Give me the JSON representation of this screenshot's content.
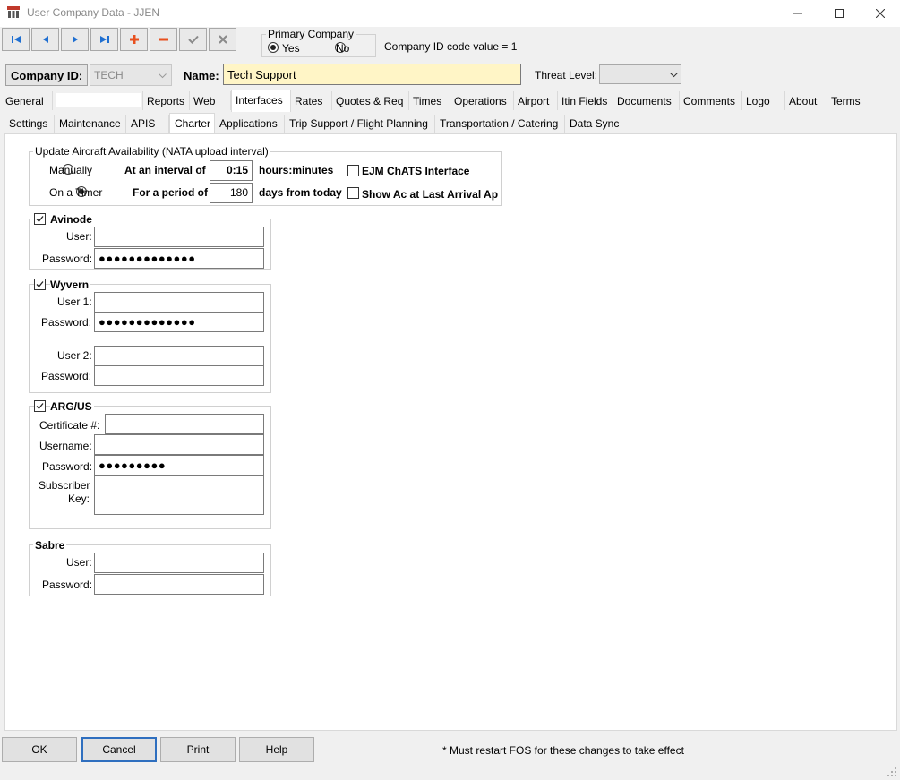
{
  "window": {
    "title": "User Company Data - JJEN",
    "minimize": "minimize",
    "maximize": "maximize",
    "close": "close"
  },
  "toolbar": {
    "icons": [
      "first-record-icon",
      "previous-record-icon",
      "next-record-icon",
      "last-record-icon",
      "add-record-icon",
      "delete-record-icon",
      "accept-icon",
      "cancel-edit-icon"
    ]
  },
  "primary_company": {
    "label": "Primary Company",
    "yes": "Yes",
    "no": "No",
    "selected": "Yes"
  },
  "company_id_code": "Company ID code value = 1",
  "company": {
    "id_label": "Company ID:",
    "id_value": "TECH",
    "name_label": "Name:",
    "name_value": "Tech Support",
    "threat_label": "Threat Level:",
    "threat_value": ""
  },
  "main_tabs": [
    "General",
    "",
    "Reports",
    "Web",
    "Interfaces",
    "Rates",
    "Quotes & Req",
    "Times",
    "Operations",
    "Airport",
    "Itin Fields",
    "Documents",
    "Comments",
    "Logo",
    "About",
    "Terms"
  ],
  "active_main_tab": "Interfaces",
  "sub_tabs": [
    "Settings",
    "Maintenance",
    "APIS",
    "Charter",
    "Applications",
    "Trip Support / Flight Planning",
    "Transportation / Catering",
    "Data Sync"
  ],
  "active_sub_tab": "Charter",
  "aircraft_availability": {
    "legend": "Update Aircraft Availability (NATA upload interval)",
    "manually": "Manually",
    "on_timer": "On a Timer",
    "selected": "On a Timer",
    "interval_label": "At an interval of",
    "interval_value": "0:15",
    "interval_unit": "hours:minutes",
    "period_label": "For a period of",
    "period_value": "180",
    "period_unit": "days from today",
    "ejm_label": "EJM ChATS Interface",
    "ejm_checked": false,
    "show_ac_label": "Show Ac at Last Arrival Ap",
    "show_ac_checked": false
  },
  "avinode": {
    "label": "Avinode",
    "checked": true,
    "user_label": "User:",
    "user_value": "",
    "password_label": "Password:",
    "password_value": "●●●●●●●●●●●●●"
  },
  "wyvern": {
    "label": "Wyvern",
    "checked": true,
    "user1_label": "User 1:",
    "user1_value": "",
    "password1_label": "Password:",
    "password1_value": "●●●●●●●●●●●●●",
    "user2_label": "User 2:",
    "user2_value": "",
    "password2_label": "Password:",
    "password2_value": ""
  },
  "argus": {
    "label": "ARG/US",
    "checked": true,
    "certificate_label": "Certificate #:",
    "certificate_value": "",
    "username_label": "Username:",
    "username_value": "",
    "password_label": "Password:",
    "password_value": "●●●●●●●●●",
    "subscriber_label_1": "Subscriber",
    "subscriber_label_2": "Key:",
    "subscriber_value": ""
  },
  "sabre": {
    "label": "Sabre",
    "user_label": "User:",
    "user_value": "",
    "password_label": "Password:",
    "password_value": ""
  },
  "buttons": {
    "ok": "OK",
    "cancel": "Cancel",
    "print": "Print",
    "help": "Help"
  },
  "restart_note": "* Must restart FOS for these changes to take effect",
  "colors": {
    "name_field_bg": "#fff5c6",
    "add_icon": "#e8501e",
    "delete_icon": "#e8501e",
    "nav_icon": "#1f6fd1"
  }
}
